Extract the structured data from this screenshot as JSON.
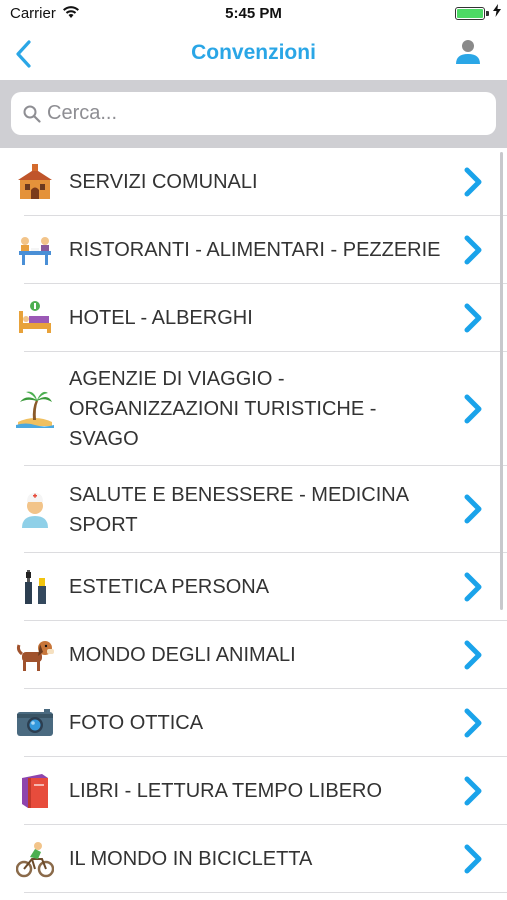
{
  "status_bar": {
    "carrier": "Carrier",
    "time": "5:45 PM",
    "battery_level": 1.0
  },
  "nav": {
    "title": "Convenzioni",
    "back_icon": "chevron-left-icon",
    "user_icon": "user-icon",
    "accent": "#2aa6e6"
  },
  "search": {
    "placeholder": "Cerca...",
    "value": ""
  },
  "list": {
    "items": [
      {
        "label": "SERVIZI COMUNALI",
        "icon": "town-hall-icon"
      },
      {
        "label": "RISTORANTI - ALIMENTARI - PEZZERIE",
        "icon": "restaurant-icon"
      },
      {
        "label": "HOTEL - ALBERGHI",
        "icon": "hotel-bed-icon"
      },
      {
        "label": "AGENZIE DI VIAGGIO - ORGANIZZAZIONI TURISTICHE - SVAGO",
        "icon": "palm-island-icon"
      },
      {
        "label": "SALUTE E BENESSERE - MEDICINA SPORT",
        "icon": "doctor-icon"
      },
      {
        "label": "ESTETICA PERSONA",
        "icon": "mascara-icon"
      },
      {
        "label": "MONDO DEGLI ANIMALI",
        "icon": "dog-icon"
      },
      {
        "label": "FOTO OTTICA",
        "icon": "camera-icon"
      },
      {
        "label": "LIBRI - LETTURA TEMPO LIBERO",
        "icon": "book-icon"
      },
      {
        "label": "IL MONDO IN BICICLETTA",
        "icon": "cyclist-icon"
      }
    ],
    "chevron_color": "#1aa3ea"
  }
}
